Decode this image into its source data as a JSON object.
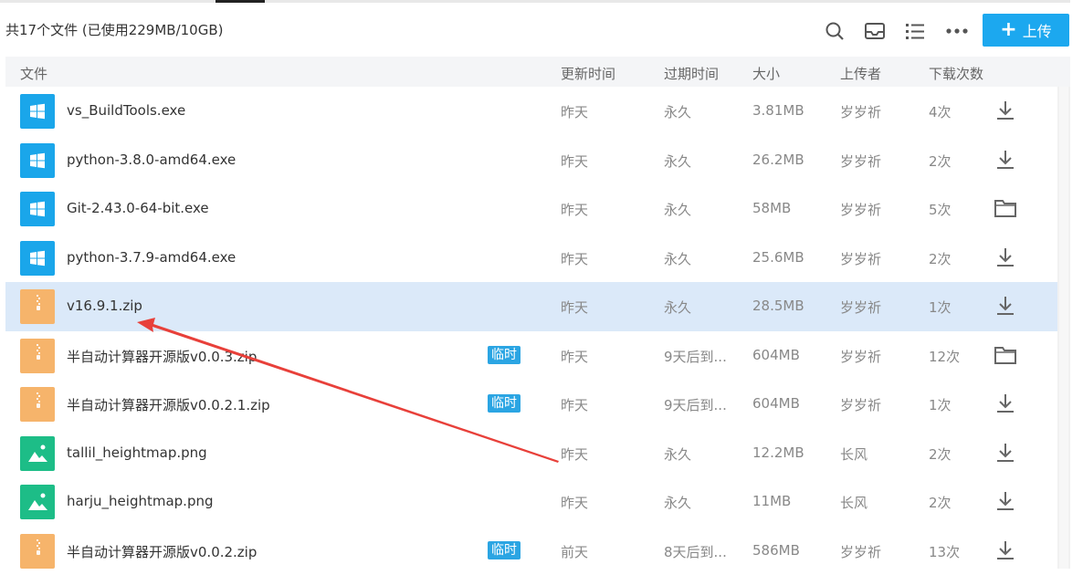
{
  "toolbar": {
    "summary": "共17个文件 (已使用229MB/10GB)",
    "upload_label": "上传",
    "icons": [
      "search-icon",
      "inbox-icon",
      "list-view-icon",
      "more-icon"
    ]
  },
  "columns": {
    "file": "文件",
    "updated": "更新时间",
    "expires": "过期时间",
    "size": "大小",
    "uploader": "上传者",
    "downloads": "下载次数"
  },
  "files": [
    {
      "name": "vs_BuildTools.exe",
      "type": "exe",
      "temp": "",
      "updated": "昨天",
      "expires": "永久",
      "size": "3.81MB",
      "uploader": "岁岁祈",
      "downloads": "4次",
      "action": "download"
    },
    {
      "name": "python-3.8.0-amd64.exe",
      "type": "exe",
      "temp": "",
      "updated": "昨天",
      "expires": "永久",
      "size": "26.2MB",
      "uploader": "岁岁祈",
      "downloads": "2次",
      "action": "download"
    },
    {
      "name": "Git-2.43.0-64-bit.exe",
      "type": "exe",
      "temp": "",
      "updated": "昨天",
      "expires": "永久",
      "size": "58MB",
      "uploader": "岁岁祈",
      "downloads": "5次",
      "action": "folder"
    },
    {
      "name": "python-3.7.9-amd64.exe",
      "type": "exe",
      "temp": "",
      "updated": "昨天",
      "expires": "永久",
      "size": "25.6MB",
      "uploader": "岁岁祈",
      "downloads": "2次",
      "action": "download"
    },
    {
      "name": "v16.9.1.zip",
      "type": "zip",
      "temp": "",
      "updated": "昨天",
      "expires": "永久",
      "size": "28.5MB",
      "uploader": "岁岁祈",
      "downloads": "1次",
      "action": "download",
      "selected": true
    },
    {
      "name": "半自动计算器开源版v0.0.3.zip",
      "type": "zip",
      "temp": "临时",
      "updated": "昨天",
      "expires": "9天后到...",
      "size": "604MB",
      "uploader": "岁岁祈",
      "downloads": "12次",
      "action": "folder"
    },
    {
      "name": "半自动计算器开源版v0.0.2.1.zip",
      "type": "zip",
      "temp": "临时",
      "updated": "昨天",
      "expires": "9天后到...",
      "size": "604MB",
      "uploader": "岁岁祈",
      "downloads": "1次",
      "action": "download"
    },
    {
      "name": "tallil_heightmap.png",
      "type": "img",
      "temp": "",
      "updated": "昨天",
      "expires": "永久",
      "size": "12.2MB",
      "uploader": "长风",
      "downloads": "2次",
      "action": "download"
    },
    {
      "name": "harju_heightmap.png",
      "type": "img",
      "temp": "",
      "updated": "昨天",
      "expires": "永久",
      "size": "11MB",
      "uploader": "长风",
      "downloads": "2次",
      "action": "download"
    },
    {
      "name": "半自动计算器开源版v0.0.2.zip",
      "type": "zip",
      "temp": "临时",
      "updated": "前天",
      "expires": "8天后到...",
      "size": "586MB",
      "uploader": "岁岁祈",
      "downloads": "13次",
      "action": "download"
    }
  ],
  "colors": {
    "accent": "#1ca8ef",
    "selected_row": "#dbe9f9",
    "annotation_arrow": "#e8403a"
  }
}
